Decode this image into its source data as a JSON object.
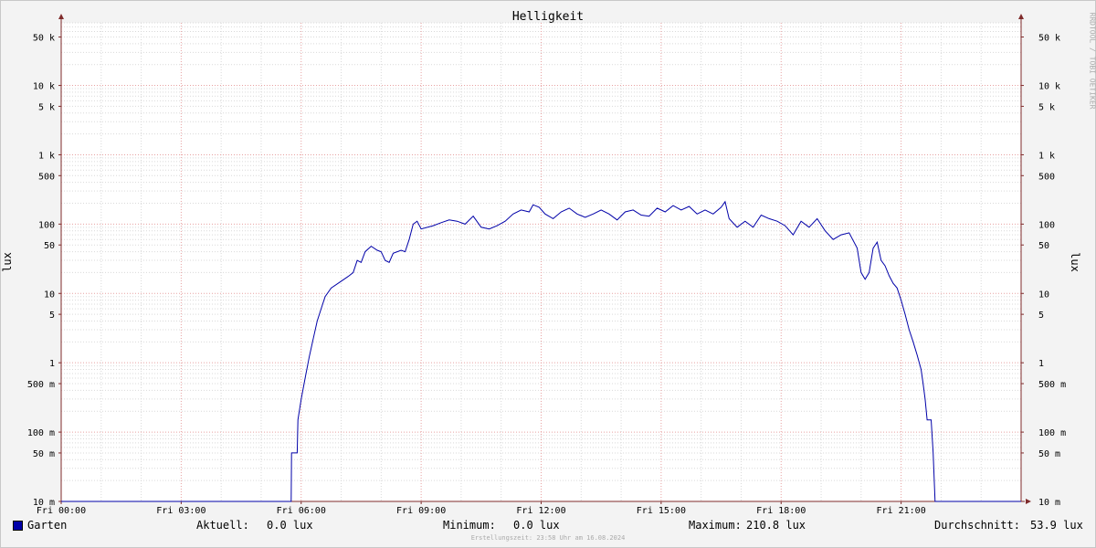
{
  "chart_data": {
    "type": "line",
    "title": "Helligkeit",
    "ylabel": "lux",
    "yscale": "log",
    "ylim": [
      0.01,
      80000
    ],
    "xlim": [
      0,
      24
    ],
    "x_unit": "hours",
    "grid": true,
    "x_ticks": [
      {
        "x": 0,
        "label": "Fri 00:00"
      },
      {
        "x": 3,
        "label": "Fri 03:00"
      },
      {
        "x": 6,
        "label": "Fri 06:00"
      },
      {
        "x": 9,
        "label": "Fri 09:00"
      },
      {
        "x": 12,
        "label": "Fri 12:00"
      },
      {
        "x": 15,
        "label": "Fri 15:00"
      },
      {
        "x": 18,
        "label": "Fri 18:00"
      },
      {
        "x": 21,
        "label": "Fri 21:00"
      }
    ],
    "y_ticks": [
      {
        "v": 0.01,
        "label": "10 m"
      },
      {
        "v": 0.05,
        "label": "50 m"
      },
      {
        "v": 0.1,
        "label": "100 m"
      },
      {
        "v": 0.5,
        "label": "500 m"
      },
      {
        "v": 1,
        "label": "1"
      },
      {
        "v": 5,
        "label": "5"
      },
      {
        "v": 10,
        "label": "10"
      },
      {
        "v": 50,
        "label": "50"
      },
      {
        "v": 100,
        "label": "100"
      },
      {
        "v": 500,
        "label": "500"
      },
      {
        "v": 1000,
        "label": "1 k"
      },
      {
        "v": 5000,
        "label": "5 k"
      },
      {
        "v": 10000,
        "label": "10 k"
      },
      {
        "v": 50000,
        "label": "50 k"
      }
    ],
    "series": [
      {
        "name": "Garten",
        "color": "#0000a8",
        "points": [
          [
            0,
            0.01
          ],
          [
            5.75,
            0.01
          ],
          [
            5.76,
            0.05
          ],
          [
            5.9,
            0.05
          ],
          [
            5.92,
            0.15
          ],
          [
            6.0,
            0.3
          ],
          [
            6.1,
            0.6
          ],
          [
            6.2,
            1.2
          ],
          [
            6.3,
            2.2
          ],
          [
            6.4,
            4.0
          ],
          [
            6.5,
            6.0
          ],
          [
            6.6,
            9.0
          ],
          [
            6.75,
            12.0
          ],
          [
            7.0,
            15.0
          ],
          [
            7.2,
            18.0
          ],
          [
            7.3,
            20.0
          ],
          [
            7.4,
            30.0
          ],
          [
            7.5,
            28.0
          ],
          [
            7.6,
            40.0
          ],
          [
            7.75,
            48.0
          ],
          [
            7.9,
            42.0
          ],
          [
            8.0,
            40.0
          ],
          [
            8.1,
            30.0
          ],
          [
            8.2,
            28.0
          ],
          [
            8.3,
            38.0
          ],
          [
            8.5,
            42.0
          ],
          [
            8.6,
            40.0
          ],
          [
            8.7,
            60.0
          ],
          [
            8.8,
            100.0
          ],
          [
            8.9,
            110.0
          ],
          [
            9.0,
            85.0
          ],
          [
            9.3,
            95.0
          ],
          [
            9.5,
            105.0
          ],
          [
            9.7,
            115.0
          ],
          [
            9.9,
            110.0
          ],
          [
            10.1,
            100.0
          ],
          [
            10.3,
            130.0
          ],
          [
            10.5,
            90.0
          ],
          [
            10.7,
            85.0
          ],
          [
            10.9,
            95.0
          ],
          [
            11.1,
            110.0
          ],
          [
            11.3,
            140.0
          ],
          [
            11.5,
            160.0
          ],
          [
            11.7,
            150.0
          ],
          [
            11.8,
            190.0
          ],
          [
            11.95,
            175.0
          ],
          [
            12.1,
            140.0
          ],
          [
            12.3,
            120.0
          ],
          [
            12.5,
            150.0
          ],
          [
            12.7,
            170.0
          ],
          [
            12.9,
            140.0
          ],
          [
            13.1,
            125.0
          ],
          [
            13.3,
            140.0
          ],
          [
            13.5,
            160.0
          ],
          [
            13.7,
            140.0
          ],
          [
            13.9,
            115.0
          ],
          [
            14.1,
            150.0
          ],
          [
            14.3,
            160.0
          ],
          [
            14.5,
            135.0
          ],
          [
            14.7,
            130.0
          ],
          [
            14.9,
            170.0
          ],
          [
            15.1,
            150.0
          ],
          [
            15.3,
            185.0
          ],
          [
            15.5,
            160.0
          ],
          [
            15.7,
            180.0
          ],
          [
            15.9,
            140.0
          ],
          [
            16.1,
            160.0
          ],
          [
            16.3,
            140.0
          ],
          [
            16.5,
            175.0
          ],
          [
            16.6,
            210.8
          ],
          [
            16.7,
            120.0
          ],
          [
            16.9,
            90.0
          ],
          [
            17.1,
            110.0
          ],
          [
            17.3,
            90.0
          ],
          [
            17.5,
            135.0
          ],
          [
            17.7,
            120.0
          ],
          [
            17.9,
            110.0
          ],
          [
            18.1,
            95.0
          ],
          [
            18.3,
            70.0
          ],
          [
            18.5,
            110.0
          ],
          [
            18.7,
            90.0
          ],
          [
            18.9,
            120.0
          ],
          [
            19.1,
            80.0
          ],
          [
            19.3,
            60.0
          ],
          [
            19.5,
            70.0
          ],
          [
            19.7,
            75.0
          ],
          [
            19.9,
            45.0
          ],
          [
            20.0,
            20.0
          ],
          [
            20.1,
            16.0
          ],
          [
            20.2,
            20.0
          ],
          [
            20.3,
            45.0
          ],
          [
            20.4,
            55.0
          ],
          [
            20.5,
            30.0
          ],
          [
            20.6,
            25.0
          ],
          [
            20.7,
            18.0
          ],
          [
            20.8,
            14.0
          ],
          [
            20.9,
            12.0
          ],
          [
            21.0,
            8.0
          ],
          [
            21.1,
            5.0
          ],
          [
            21.2,
            3.0
          ],
          [
            21.3,
            2.0
          ],
          [
            21.4,
            1.3
          ],
          [
            21.5,
            0.8
          ],
          [
            21.55,
            0.5
          ],
          [
            21.6,
            0.3
          ],
          [
            21.65,
            0.15
          ],
          [
            21.75,
            0.15
          ],
          [
            21.8,
            0.05
          ],
          [
            21.85,
            0.01
          ],
          [
            24,
            0.01
          ]
        ]
      }
    ]
  },
  "legend": {
    "series_name": "Garten",
    "current_label": "Aktuell:",
    "current_value": "0.0 lux",
    "min_label": "Minimum:",
    "min_value": "0.0 lux",
    "max_label": "Maximum:",
    "max_value": "210.8 lux",
    "avg_label": "Durchschnitt:",
    "avg_value": "53.9 lux"
  },
  "footer": "Erstellungszeit: 23:58 Uhr am 16.08.2024",
  "watermark": "RRDTOOL / TOBI OETIKER",
  "colors": {
    "background": "#f3f3f3",
    "plot_bg": "#ffffff",
    "major_grid": "#e7a1a1",
    "minor_grid": "#d9d9d9",
    "axis": "#7f2b2b",
    "line": "#0000a8"
  }
}
